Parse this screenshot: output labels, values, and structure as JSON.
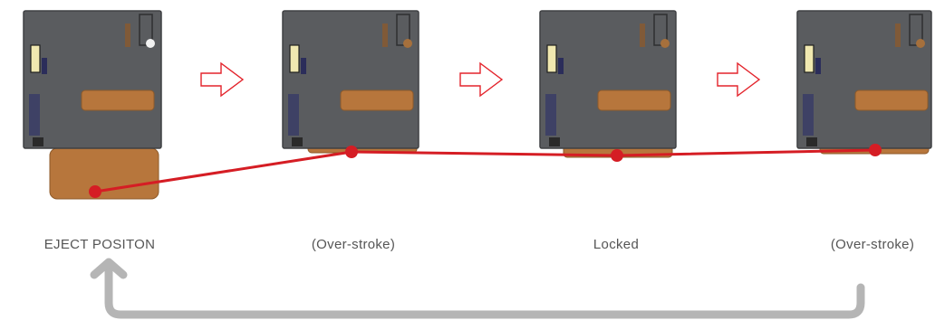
{
  "title": "",
  "colors": {
    "housing": "#5a5c5f",
    "housing_edge": "#3f4043",
    "card": "#b7763c",
    "card_edge": "#8d5a2a",
    "track": "#d51d24",
    "arrow": "#e3232b",
    "return_arrow": "#b5b5b5",
    "label": "#555555"
  },
  "stages": [
    {
      "label": "EJECT POSITON",
      "card_state": "ejected"
    },
    {
      "label": "(Over-stroke)",
      "card_state": "over-stroke"
    },
    {
      "label": "Locked",
      "card_state": "locked"
    },
    {
      "label": "(Over-stroke)",
      "card_state": "over-stroke"
    }
  ],
  "icons": {
    "step_arrow": "hollow-right-arrow-icon",
    "return_arrow": "return-loop-arrow-icon"
  }
}
